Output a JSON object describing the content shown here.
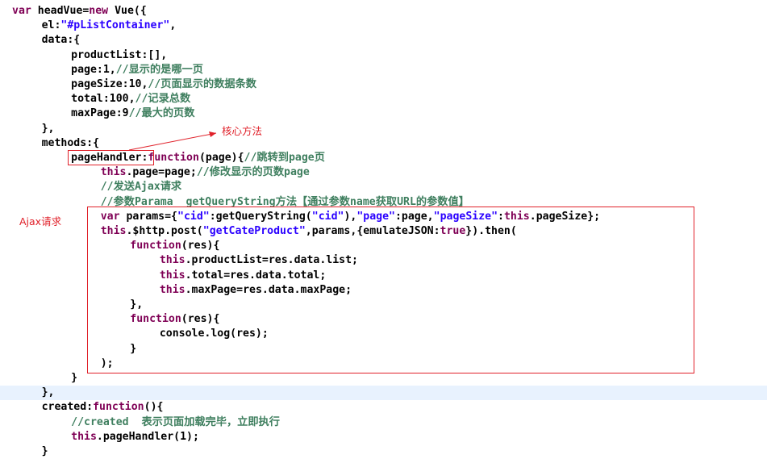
{
  "code": {
    "lines": [
      {
        "indent": 0,
        "segments": [
          {
            "t": "var ",
            "c": "kw"
          },
          {
            "t": "headVue=",
            "c": ""
          },
          {
            "t": "new ",
            "c": "kw"
          },
          {
            "t": "Vue({",
            "c": ""
          }
        ]
      },
      {
        "indent": 4,
        "segments": [
          {
            "t": "el:",
            "c": ""
          },
          {
            "t": "\"#pListContainer\"",
            "c": "str"
          },
          {
            "t": ",",
            "c": ""
          }
        ]
      },
      {
        "indent": 4,
        "segments": [
          {
            "t": "data:{",
            "c": ""
          }
        ]
      },
      {
        "indent": 8,
        "segments": [
          {
            "t": "productList:[],",
            "c": ""
          }
        ]
      },
      {
        "indent": 8,
        "segments": [
          {
            "t": "page:1,",
            "c": ""
          },
          {
            "t": "//显示的是哪一页",
            "c": "cmt"
          }
        ]
      },
      {
        "indent": 8,
        "segments": [
          {
            "t": "pageSize:10,",
            "c": ""
          },
          {
            "t": "//页面显示的数据条数",
            "c": "cmt"
          }
        ]
      },
      {
        "indent": 8,
        "segments": [
          {
            "t": "total:100,",
            "c": ""
          },
          {
            "t": "//记录总数",
            "c": "cmt"
          }
        ]
      },
      {
        "indent": 8,
        "segments": [
          {
            "t": "maxPage:9",
            "c": ""
          },
          {
            "t": "//最大的页数",
            "c": "cmt"
          }
        ]
      },
      {
        "indent": 4,
        "segments": [
          {
            "t": "},",
            "c": ""
          }
        ]
      },
      {
        "indent": 4,
        "segments": [
          {
            "t": "methods:{",
            "c": ""
          }
        ]
      },
      {
        "indent": 8,
        "segments": [
          {
            "t": "pageHandler:",
            "c": ""
          },
          {
            "t": "function",
            "c": "kw"
          },
          {
            "t": "(page){",
            "c": ""
          },
          {
            "t": "//跳转到page页",
            "c": "cmt"
          }
        ]
      },
      {
        "indent": 12,
        "segments": [
          {
            "t": "this",
            "c": "kw"
          },
          {
            "t": ".page=page;",
            "c": ""
          },
          {
            "t": "//修改显示的页数page",
            "c": "cmt"
          }
        ]
      },
      {
        "indent": 12,
        "segments": [
          {
            "t": "//发送Ajax请求",
            "c": "cmt"
          }
        ]
      },
      {
        "indent": 12,
        "segments": [
          {
            "t": "//参数Parama  getQueryString方法【通过参数name获取URL的参数值】",
            "c": "cmt"
          }
        ]
      },
      {
        "indent": 12,
        "segments": [
          {
            "t": "var ",
            "c": "kw"
          },
          {
            "t": "params={",
            "c": ""
          },
          {
            "t": "\"cid\"",
            "c": "str"
          },
          {
            "t": ":getQueryString(",
            "c": ""
          },
          {
            "t": "\"cid\"",
            "c": "str"
          },
          {
            "t": "),",
            "c": ""
          },
          {
            "t": "\"page\"",
            "c": "str"
          },
          {
            "t": ":page,",
            "c": ""
          },
          {
            "t": "\"pageSize\"",
            "c": "str"
          },
          {
            "t": ":",
            "c": ""
          },
          {
            "t": "this",
            "c": "kw"
          },
          {
            "t": ".pageSize};",
            "c": ""
          }
        ]
      },
      {
        "indent": 12,
        "segments": [
          {
            "t": "this",
            "c": "kw"
          },
          {
            "t": ".$http.post(",
            "c": ""
          },
          {
            "t": "\"getCateProduct\"",
            "c": "str"
          },
          {
            "t": ",params,{emulateJSON:",
            "c": ""
          },
          {
            "t": "true",
            "c": "kw"
          },
          {
            "t": "}).then(",
            "c": ""
          }
        ]
      },
      {
        "indent": 16,
        "segments": [
          {
            "t": "function",
            "c": "kw"
          },
          {
            "t": "(res){",
            "c": ""
          }
        ]
      },
      {
        "indent": 20,
        "segments": [
          {
            "t": "this",
            "c": "kw"
          },
          {
            "t": ".productList=res.data.list;",
            "c": ""
          }
        ]
      },
      {
        "indent": 20,
        "segments": [
          {
            "t": "this",
            "c": "kw"
          },
          {
            "t": ".total=res.data.total;",
            "c": ""
          }
        ]
      },
      {
        "indent": 20,
        "segments": [
          {
            "t": "this",
            "c": "kw"
          },
          {
            "t": ".maxPage=res.data.maxPage;",
            "c": ""
          }
        ]
      },
      {
        "indent": 16,
        "segments": [
          {
            "t": "},",
            "c": ""
          }
        ]
      },
      {
        "indent": 16,
        "segments": [
          {
            "t": "function",
            "c": "kw"
          },
          {
            "t": "(res){",
            "c": ""
          }
        ]
      },
      {
        "indent": 20,
        "segments": [
          {
            "t": "console.log(res);",
            "c": ""
          }
        ]
      },
      {
        "indent": 16,
        "segments": [
          {
            "t": "}",
            "c": ""
          }
        ]
      },
      {
        "indent": 12,
        "segments": [
          {
            "t": ");",
            "c": ""
          }
        ]
      },
      {
        "indent": 8,
        "segments": [
          {
            "t": "}",
            "c": ""
          }
        ]
      },
      {
        "indent": 4,
        "segments": [
          {
            "t": "},",
            "c": ""
          }
        ],
        "highlight": true
      },
      {
        "indent": 4,
        "segments": [
          {
            "t": "created:",
            "c": ""
          },
          {
            "t": "function",
            "c": "kw"
          },
          {
            "t": "(){",
            "c": ""
          }
        ]
      },
      {
        "indent": 8,
        "segments": [
          {
            "t": "//created  表示页面加载完毕，立即执行",
            "c": "cmt"
          }
        ]
      },
      {
        "indent": 8,
        "segments": [
          {
            "t": "this",
            "c": "kw"
          },
          {
            "t": ".pageHandler(1);",
            "c": ""
          }
        ]
      },
      {
        "indent": 4,
        "segments": [
          {
            "t": "}",
            "c": ""
          }
        ]
      }
    ]
  },
  "annotations": {
    "core_method": "核心方法",
    "ajax_request": "Ajax请求"
  },
  "colors": {
    "keyword": "#7f0055",
    "string": "#2a00ff",
    "comment": "#3f7f5f",
    "annotation": "#e0212a",
    "current_line": "#e8f2fe"
  }
}
